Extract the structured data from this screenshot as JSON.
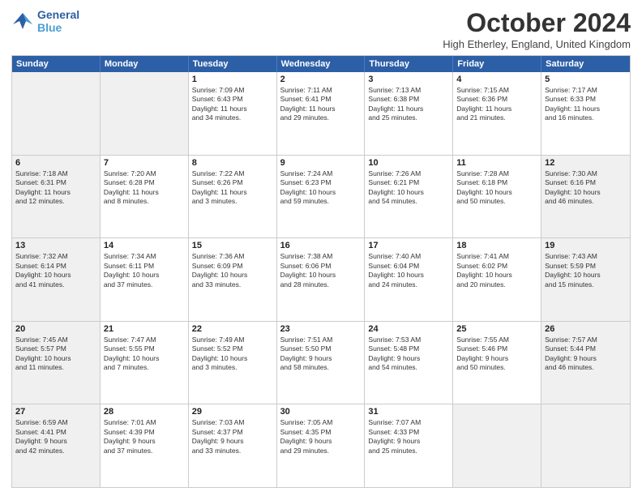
{
  "header": {
    "logo_line1": "General",
    "logo_line2": "Blue",
    "month": "October 2024",
    "location": "High Etherley, England, United Kingdom"
  },
  "weekdays": [
    "Sunday",
    "Monday",
    "Tuesday",
    "Wednesday",
    "Thursday",
    "Friday",
    "Saturday"
  ],
  "rows": [
    [
      {
        "day": "",
        "info": "",
        "shaded": true,
        "empty": true
      },
      {
        "day": "",
        "info": "",
        "shaded": true,
        "empty": true
      },
      {
        "day": "1",
        "info": "Sunrise: 7:09 AM\nSunset: 6:43 PM\nDaylight: 11 hours\nand 34 minutes.",
        "shaded": false
      },
      {
        "day": "2",
        "info": "Sunrise: 7:11 AM\nSunset: 6:41 PM\nDaylight: 11 hours\nand 29 minutes.",
        "shaded": false
      },
      {
        "day": "3",
        "info": "Sunrise: 7:13 AM\nSunset: 6:38 PM\nDaylight: 11 hours\nand 25 minutes.",
        "shaded": false
      },
      {
        "day": "4",
        "info": "Sunrise: 7:15 AM\nSunset: 6:36 PM\nDaylight: 11 hours\nand 21 minutes.",
        "shaded": false
      },
      {
        "day": "5",
        "info": "Sunrise: 7:17 AM\nSunset: 6:33 PM\nDaylight: 11 hours\nand 16 minutes.",
        "shaded": false
      }
    ],
    [
      {
        "day": "6",
        "info": "Sunrise: 7:18 AM\nSunset: 6:31 PM\nDaylight: 11 hours\nand 12 minutes.",
        "shaded": true
      },
      {
        "day": "7",
        "info": "Sunrise: 7:20 AM\nSunset: 6:28 PM\nDaylight: 11 hours\nand 8 minutes.",
        "shaded": false
      },
      {
        "day": "8",
        "info": "Sunrise: 7:22 AM\nSunset: 6:26 PM\nDaylight: 11 hours\nand 3 minutes.",
        "shaded": false
      },
      {
        "day": "9",
        "info": "Sunrise: 7:24 AM\nSunset: 6:23 PM\nDaylight: 10 hours\nand 59 minutes.",
        "shaded": false
      },
      {
        "day": "10",
        "info": "Sunrise: 7:26 AM\nSunset: 6:21 PM\nDaylight: 10 hours\nand 54 minutes.",
        "shaded": false
      },
      {
        "day": "11",
        "info": "Sunrise: 7:28 AM\nSunset: 6:18 PM\nDaylight: 10 hours\nand 50 minutes.",
        "shaded": false
      },
      {
        "day": "12",
        "info": "Sunrise: 7:30 AM\nSunset: 6:16 PM\nDaylight: 10 hours\nand 46 minutes.",
        "shaded": true
      }
    ],
    [
      {
        "day": "13",
        "info": "Sunrise: 7:32 AM\nSunset: 6:14 PM\nDaylight: 10 hours\nand 41 minutes.",
        "shaded": true
      },
      {
        "day": "14",
        "info": "Sunrise: 7:34 AM\nSunset: 6:11 PM\nDaylight: 10 hours\nand 37 minutes.",
        "shaded": false
      },
      {
        "day": "15",
        "info": "Sunrise: 7:36 AM\nSunset: 6:09 PM\nDaylight: 10 hours\nand 33 minutes.",
        "shaded": false
      },
      {
        "day": "16",
        "info": "Sunrise: 7:38 AM\nSunset: 6:06 PM\nDaylight: 10 hours\nand 28 minutes.",
        "shaded": false
      },
      {
        "day": "17",
        "info": "Sunrise: 7:40 AM\nSunset: 6:04 PM\nDaylight: 10 hours\nand 24 minutes.",
        "shaded": false
      },
      {
        "day": "18",
        "info": "Sunrise: 7:41 AM\nSunset: 6:02 PM\nDaylight: 10 hours\nand 20 minutes.",
        "shaded": false
      },
      {
        "day": "19",
        "info": "Sunrise: 7:43 AM\nSunset: 5:59 PM\nDaylight: 10 hours\nand 15 minutes.",
        "shaded": true
      }
    ],
    [
      {
        "day": "20",
        "info": "Sunrise: 7:45 AM\nSunset: 5:57 PM\nDaylight: 10 hours\nand 11 minutes.",
        "shaded": true
      },
      {
        "day": "21",
        "info": "Sunrise: 7:47 AM\nSunset: 5:55 PM\nDaylight: 10 hours\nand 7 minutes.",
        "shaded": false
      },
      {
        "day": "22",
        "info": "Sunrise: 7:49 AM\nSunset: 5:52 PM\nDaylight: 10 hours\nand 3 minutes.",
        "shaded": false
      },
      {
        "day": "23",
        "info": "Sunrise: 7:51 AM\nSunset: 5:50 PM\nDaylight: 9 hours\nand 58 minutes.",
        "shaded": false
      },
      {
        "day": "24",
        "info": "Sunrise: 7:53 AM\nSunset: 5:48 PM\nDaylight: 9 hours\nand 54 minutes.",
        "shaded": false
      },
      {
        "day": "25",
        "info": "Sunrise: 7:55 AM\nSunset: 5:46 PM\nDaylight: 9 hours\nand 50 minutes.",
        "shaded": false
      },
      {
        "day": "26",
        "info": "Sunrise: 7:57 AM\nSunset: 5:44 PM\nDaylight: 9 hours\nand 46 minutes.",
        "shaded": true
      }
    ],
    [
      {
        "day": "27",
        "info": "Sunrise: 6:59 AM\nSunset: 4:41 PM\nDaylight: 9 hours\nand 42 minutes.",
        "shaded": true
      },
      {
        "day": "28",
        "info": "Sunrise: 7:01 AM\nSunset: 4:39 PM\nDaylight: 9 hours\nand 37 minutes.",
        "shaded": false
      },
      {
        "day": "29",
        "info": "Sunrise: 7:03 AM\nSunset: 4:37 PM\nDaylight: 9 hours\nand 33 minutes.",
        "shaded": false
      },
      {
        "day": "30",
        "info": "Sunrise: 7:05 AM\nSunset: 4:35 PM\nDaylight: 9 hours\nand 29 minutes.",
        "shaded": false
      },
      {
        "day": "31",
        "info": "Sunrise: 7:07 AM\nSunset: 4:33 PM\nDaylight: 9 hours\nand 25 minutes.",
        "shaded": false
      },
      {
        "day": "",
        "info": "",
        "shaded": true,
        "empty": true
      },
      {
        "day": "",
        "info": "",
        "shaded": true,
        "empty": true
      }
    ]
  ]
}
